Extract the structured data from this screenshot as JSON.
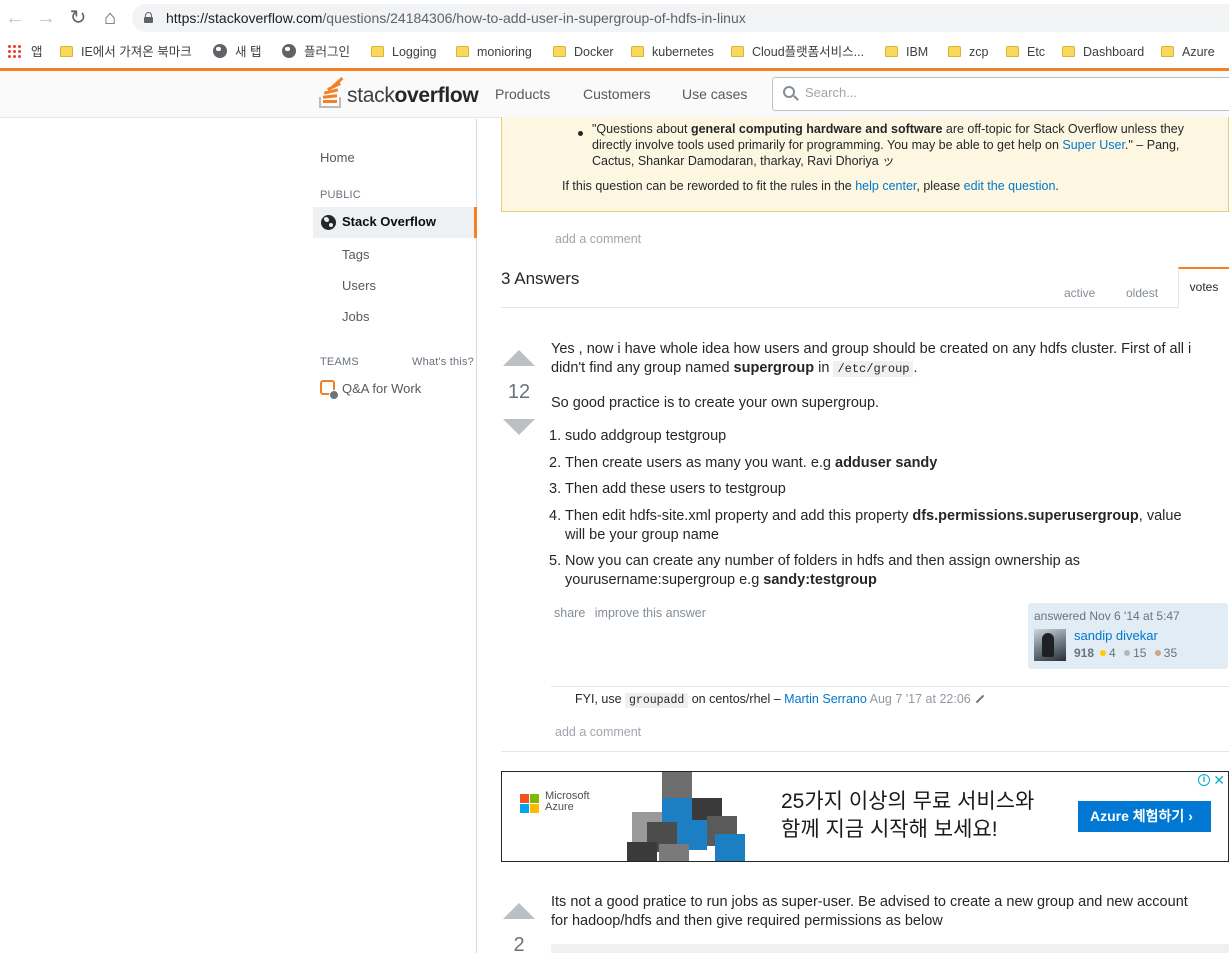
{
  "browser": {
    "url_host": "https://stackoverflow.com",
    "url_path": "/questions/24184306/how-to-add-user-in-supergroup-of-hdfs-in-linux",
    "bookmarks": [
      "앱",
      "IE에서 가져온 북마크",
      "새 탭",
      "플러그인",
      "Logging",
      "monioring",
      "Docker",
      "kubernetes",
      "Cloud플랫폼서비스...",
      "IBM",
      "zcp",
      "Etc",
      "Dashboard",
      "Azure"
    ]
  },
  "header": {
    "logo_light": "stack",
    "logo_bold": "overflow",
    "nav": [
      "Products",
      "Customers",
      "Use cases"
    ],
    "search_placeholder": "Search..."
  },
  "sidebar": {
    "home": "Home",
    "public_label": "PUBLIC",
    "stack_overflow": "Stack Overflow",
    "tags": "Tags",
    "users": "Users",
    "jobs": "Jobs",
    "teams_label": "TEAMS",
    "whats_this": "What's this?",
    "qa_for_work": "Q&A for Work"
  },
  "notice": {
    "line1_pre": "\"Questions about ",
    "line1_bold": "general computing hardware and software",
    "line1_post": " are off-topic for Stack Overflow unless they",
    "line2_pre": "directly involve tools used primarily for programming. You may be able to get help on ",
    "line2_link": "Super User",
    "line2_post": ".\" – Pang,",
    "line3": "Cactus, Shankar Damodaran, tharkay, Ravi Dhoriya ッ",
    "foot_pre": "If this question can be reworded to fit the rules in the ",
    "foot_link1": "help center",
    "foot_mid": ", please ",
    "foot_link2": "edit the question",
    "foot_post": "."
  },
  "add_comment": "add a comment",
  "answers": {
    "title": "3 Answers",
    "tabs": [
      "active",
      "oldest",
      "votes"
    ]
  },
  "answer1": {
    "votes": "12",
    "p1_a": "Yes , now i have whole idea how users and group should be created on any hdfs cluster. First of all i",
    "p1_b_pre": "didn't find any group named ",
    "p1_b_bold": "supergroup",
    "p1_b_mid": " in ",
    "p1_b_code": "/etc/group",
    "p1_b_post": ".",
    "p2": "So good practice is to create your own supergroup.",
    "steps": [
      {
        "num": "1.",
        "text": "sudo addgroup testgroup",
        "bold": ""
      },
      {
        "num": "2.",
        "text": "Then create users as many you want. e.g ",
        "bold": "adduser sandy"
      },
      {
        "num": "3.",
        "text": "Then add these users to testgroup",
        "bold": ""
      },
      {
        "num": "4.",
        "text": "Then edit hdfs-site.xml property and add this property ",
        "bold": "dfs.permissions.superusergroup",
        "post": ", value",
        "line2": "will be your group name"
      },
      {
        "num": "5.",
        "text": "Now you can create any number of folders in hdfs and then assign ownership as",
        "line2_pre": "yourusername:supergroup e.g ",
        "line2_bold": "sandy:testgroup"
      }
    ],
    "menu": [
      "share",
      "improve this answer"
    ],
    "answered": "answered Nov 6 '14 at 5:47",
    "user": "sandip divekar",
    "rep": "918",
    "gold": "4",
    "silver": "15",
    "bronze": "35",
    "comment_pre": "FYI, use ",
    "comment_code": "groupadd",
    "comment_mid": " on centos/rhel – ",
    "comment_user": "Martin Serrano",
    "comment_date": "Aug 7 '17 at 22:06"
  },
  "ad": {
    "ms_line1": "Microsoft",
    "ms_line2": "Azure",
    "headline1": "25가지 이상의 무료 서비스와",
    "headline2": "함께 지금 시작해 보세요!",
    "button": "Azure 체험하기",
    "colors": {
      "ms_red": "#f25022",
      "ms_green": "#7fba00",
      "ms_blue": "#00a4ef",
      "ms_yellow": "#ffb900",
      "azure_blue": "#0078d4"
    }
  },
  "answer2": {
    "votes": "2",
    "line1": "Its not a good pratice to run jobs as super-user. Be advised to create a new group and new account",
    "line2": "for hadoop/hdfs and then give required permissions as below"
  }
}
